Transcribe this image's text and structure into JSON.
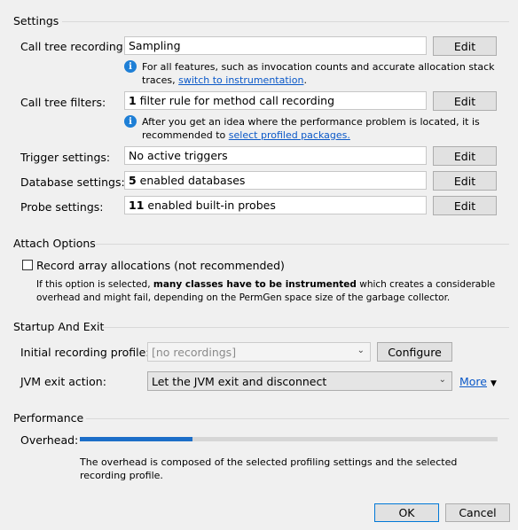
{
  "settings": {
    "title": "Settings",
    "call_tree_recording": {
      "label": "Call tree recording:",
      "value": "Sampling",
      "button": "Edit",
      "info_text": "For all features, such as invocation counts and accurate allocation stack traces,",
      "info_link": "switch to instrumentation",
      "info_suffix": "."
    },
    "call_tree_filters": {
      "label": "Call tree filters:",
      "value_bold": "1",
      "value_rest": " filter rule for method call recording",
      "button": "Edit",
      "info_text": "After you get an idea where the performance problem is located, it is recommended to",
      "info_link": "select profiled packages.",
      "info_suffix": ""
    },
    "trigger_settings": {
      "label": "Trigger settings:",
      "value": "No active triggers",
      "button": "Edit"
    },
    "database_settings": {
      "label": "Database settings:",
      "value_bold": "5",
      "value_rest": " enabled databases",
      "button": "Edit"
    },
    "probe_settings": {
      "label": "Probe settings:",
      "value_bold": "11",
      "value_rest": " enabled built-in probes",
      "button": "Edit"
    }
  },
  "attach_options": {
    "title": "Attach Options",
    "record_array_label": "Record array allocations (not recommended)",
    "record_array_checked": false,
    "note_prefix": "If this option is selected, ",
    "note_bold": "many classes have to be instrumented",
    "note_suffix": " which creates a considerable overhead and might fail, depending on the PermGen space size of the garbage collector."
  },
  "startup_exit": {
    "title": "Startup And Exit",
    "initial_profile_label": "Initial recording profile:",
    "initial_profile_value": "[no recordings]",
    "configure_button": "Configure",
    "jvm_exit_label": "JVM exit action:",
    "jvm_exit_value": "Let the JVM exit and disconnect",
    "more_link": "More"
  },
  "performance": {
    "title": "Performance",
    "overhead_label": "Overhead:",
    "overhead_level": 0.27,
    "overhead_color": "#1c6ec8",
    "note": "The overhead is composed of the selected profiling settings and the selected recording profile."
  },
  "footer": {
    "ok_button": "OK",
    "cancel_button": "Cancel"
  }
}
